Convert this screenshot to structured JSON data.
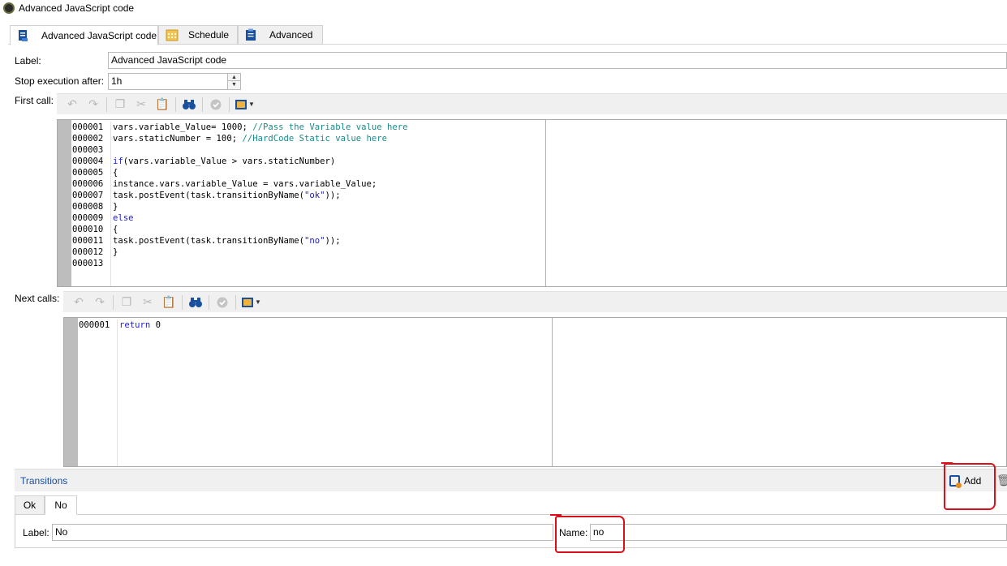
{
  "window": {
    "title": "Advanced JavaScript code"
  },
  "tabs": [
    {
      "label": "Advanced JavaScript code",
      "icon": "script-icon"
    },
    {
      "label": "Schedule",
      "icon": "calendar-icon"
    },
    {
      "label": "Advanced",
      "icon": "clipboard-icon"
    }
  ],
  "form": {
    "label_caption": "Label:",
    "label_value": "Advanced JavaScript code",
    "stop_caption": "Stop execution after:",
    "stop_value": "1h",
    "first_call_caption": "First call:",
    "next_calls_caption": "Next calls:"
  },
  "first_call": {
    "line_numbers": [
      "000001",
      "000002",
      "000003",
      "000004",
      "000005",
      "000006",
      "000007",
      "000008",
      "000009",
      "000010",
      "000011",
      "000012",
      "000013"
    ]
  },
  "next_calls": {
    "line_numbers": [
      "000001"
    ]
  },
  "transitions": {
    "title": "Transitions",
    "add_label": "Add",
    "subtabs": [
      "Ok",
      "No"
    ],
    "label_caption": "Label:",
    "label_value": "No",
    "name_caption": "Name:",
    "name_value": "no"
  },
  "colors": {
    "accent_blue": "#1a4fa0",
    "annotation_red": "#d9101a",
    "comment_teal": "#1b8a8a"
  }
}
